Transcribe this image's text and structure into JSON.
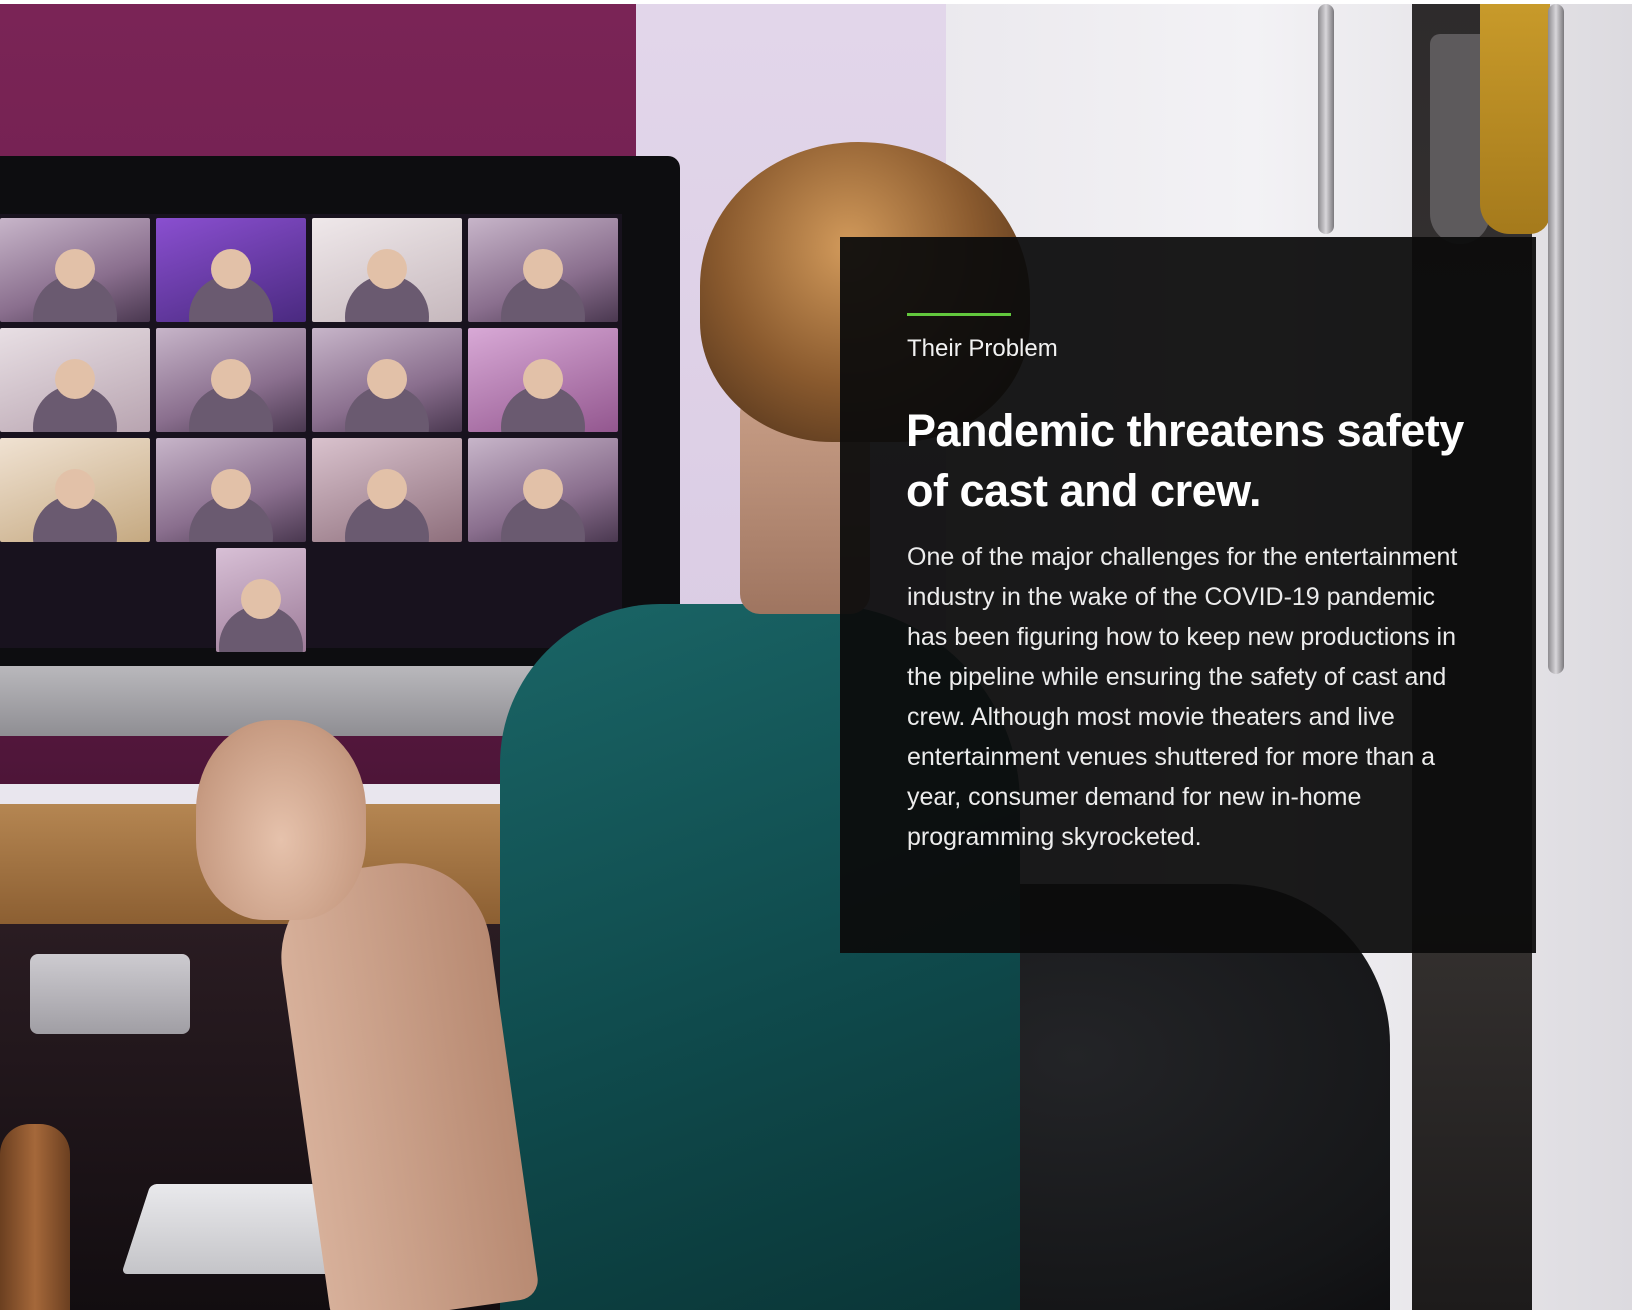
{
  "card": {
    "eyebrow": "Their Problem",
    "headline": "Pandemic threatens safety of cast and crew.",
    "body": "One of the major challenges for the entertainment industry in the wake of the COVID-19 pandemic has been figuring how to keep new productions in the pipeline while ensuring the safety of cast and crew. Although most movie theaters and live entertainment venues shuttered for more than a year, consumer demand for new in-home programming skyrocketed."
  },
  "colors": {
    "accent": "#62c83d",
    "card_background": "#0c0c0c",
    "text": "#ffffff"
  },
  "photo": {
    "subject": "person on a video call at a desktop monitor",
    "video_tiles": 13
  }
}
